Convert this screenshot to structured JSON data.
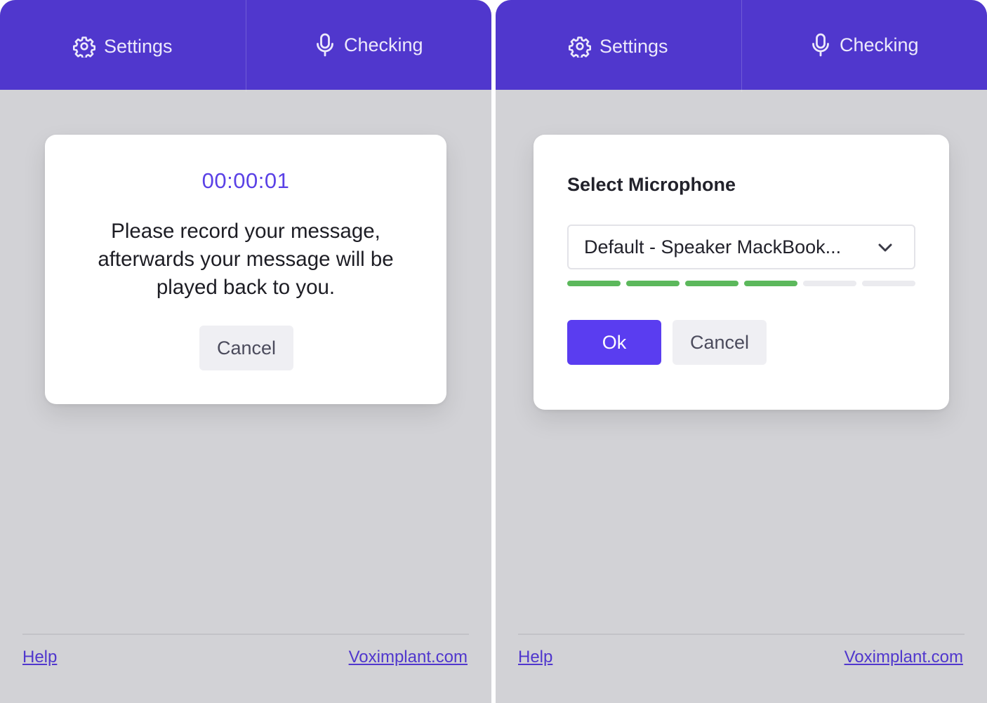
{
  "colors": {
    "accent": "#5037cd",
    "primary_button": "#5a3df0",
    "timer": "#5a41e6",
    "meter_active": "#5cb85c",
    "meter_inactive": "#ebebef",
    "background": "#d2d2d6"
  },
  "tabs": {
    "settings": {
      "label": "Settings",
      "icon": "gear-icon"
    },
    "checking": {
      "label": "Checking",
      "icon": "microphone-icon"
    }
  },
  "left_dialog": {
    "timer": "00:00:01",
    "message": "Please record your message, afterwards your message will be played back to you.",
    "cancel_label": "Cancel"
  },
  "right_dialog": {
    "title": "Select Microphone",
    "selected_device": "Default - Speaker MackBook...",
    "level_meter": {
      "active_segments": 4,
      "total_segments": 6
    },
    "ok_label": "Ok",
    "cancel_label": "Cancel"
  },
  "footer": {
    "help_label": "Help",
    "site_label": "Voximplant.com"
  }
}
